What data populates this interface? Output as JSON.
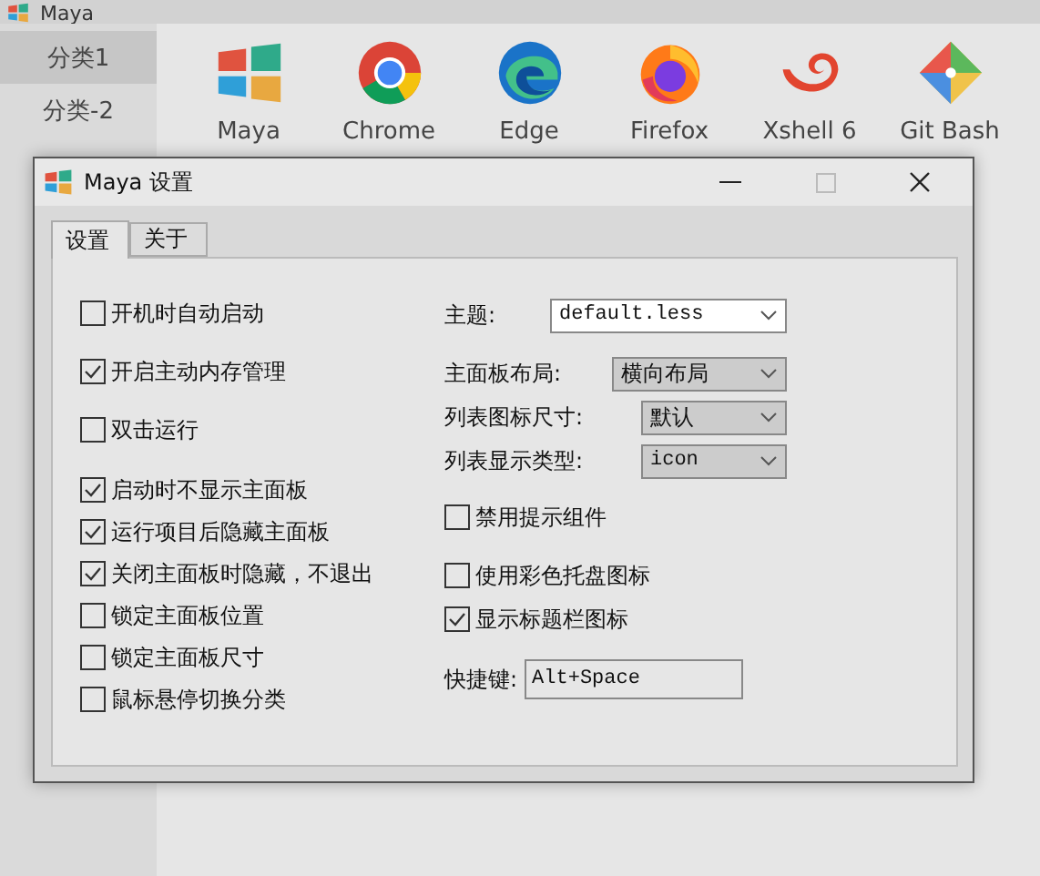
{
  "background_window": {
    "title": "Maya",
    "sidebar": [
      {
        "label": "分类1",
        "selected": true
      },
      {
        "label": "分类-2",
        "selected": false
      }
    ],
    "apps": [
      {
        "label": "Maya",
        "kind": "panes"
      },
      {
        "label": "Chrome",
        "kind": "ring"
      },
      {
        "label": "Edge",
        "kind": "wave"
      },
      {
        "label": "Firefox",
        "kind": "fox"
      },
      {
        "label": "Xshell 6",
        "kind": "shell"
      },
      {
        "label": "Git Bash",
        "kind": "diamond"
      }
    ]
  },
  "dialog": {
    "title": "Maya 设置",
    "tabs": [
      {
        "label": "设置",
        "selected": true
      },
      {
        "label": "关于",
        "selected": false
      }
    ],
    "left_options": [
      {
        "label": "开机时自动启动",
        "checked": false
      },
      {
        "label": "开启主动内存管理",
        "checked": true
      },
      {
        "label": "双击运行",
        "checked": false
      },
      {
        "label": "启动时不显示主面板",
        "checked": true
      },
      {
        "label": "运行项目后隐藏主面板",
        "checked": true
      },
      {
        "label": "关闭主面板时隐藏，不退出",
        "checked": true
      },
      {
        "label": "锁定主面板位置",
        "checked": false
      },
      {
        "label": "锁定主面板尺寸",
        "checked": false
      },
      {
        "label": "鼠标悬停切换分类",
        "checked": false
      }
    ],
    "right_options": [
      {
        "kind": "select",
        "label": "主题:",
        "value": "default.less",
        "editable": true
      },
      {
        "kind": "select",
        "label": "主面板布局:",
        "value": "横向布局",
        "editable": false
      },
      {
        "kind": "select",
        "label": "列表图标尺寸:",
        "value": "默认",
        "editable": false
      },
      {
        "kind": "select",
        "label": "列表显示类型:",
        "value": "icon",
        "editable": false
      },
      {
        "kind": "checkbox",
        "label": "禁用提示组件",
        "checked": false
      },
      {
        "kind": "checkbox",
        "label": "使用彩色托盘图标",
        "checked": false
      },
      {
        "kind": "checkbox",
        "label": "显示标题栏图标",
        "checked": true
      },
      {
        "kind": "field",
        "label": "快捷键:",
        "value": "Alt+Space"
      }
    ]
  }
}
